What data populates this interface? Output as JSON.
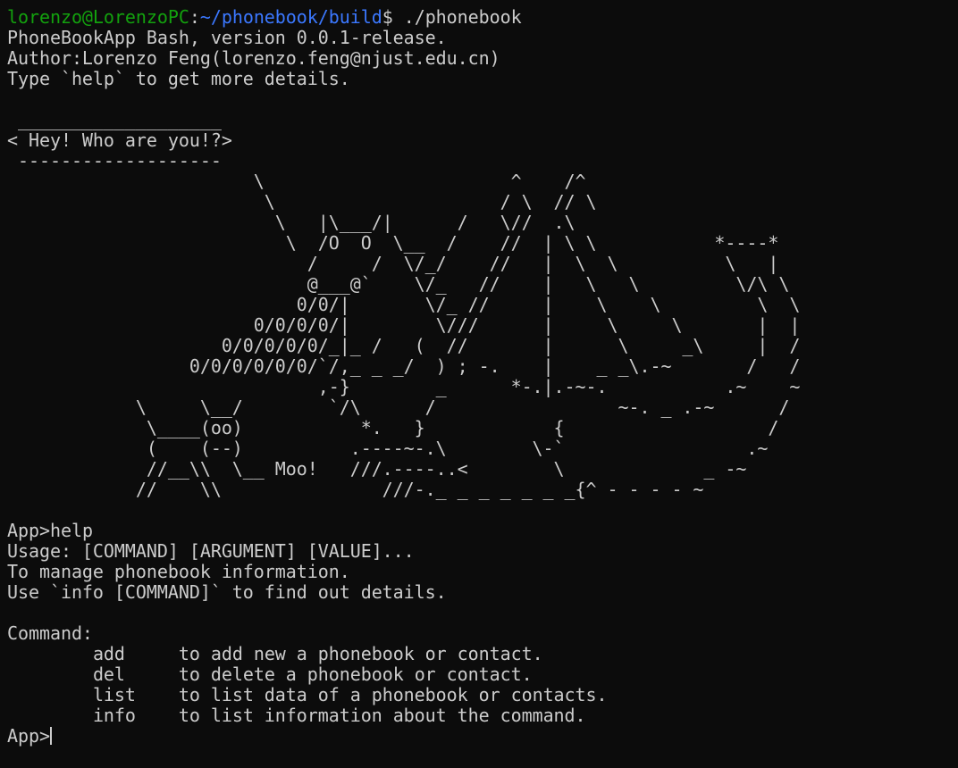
{
  "colors": {
    "background": "#0c0c0c",
    "foreground": "#cccccc",
    "prompt_user": "#13a10e",
    "prompt_path": "#3b78ff"
  },
  "shell_prompt": {
    "user_host": "lorenzo@LorenzoPC",
    "colon": ":",
    "path": "~/phonebook/build",
    "dollar": "$",
    "command": " ./phonebook"
  },
  "banner": {
    "version_line": "PhoneBookApp Bash, version 0.0.1-release.",
    "author_line": "Author:Lorenzo Feng(lorenzo.feng@njust.edu.cn)",
    "hint_line": "Type `help` to get more details."
  },
  "ascii_art": " ___________________\n< Hey! Who are you!?>\n -------------------\n                       \\                       ^    /^\n                        \\                     / \\  // \\\n                         \\   |\\___/|      /   \\//  .\\\n                          \\  /O  O  \\__  /    //  | \\ \\           *----*\n                            /     /  \\/_/    //   |  \\  \\          \\   |\n                            @___@`    \\/_   //    |   \\   \\         \\/\\ \\\n                           0/0/|       \\/_ //     |    \\    \\         \\  \\\n                       0/0/0/0/|        \\///      |     \\     \\       |  |\n                    0/0/0/0/0/_|_ /   (  //       |      \\     _\\     |  /\n                 0/0/0/0/0/0/`/,_ _ _/  ) ; -.    |    _ _\\.-~       /   /\n                             ,-}        _      *-.|.-~-.           .~    ~\n            \\     \\__/        `/\\      /                 ~-. _ .-~      /\n             \\____(oo)           *.   }            {                   /\n             (    (--)          .----~-.\\        \\-`                 .~\n             //__\\\\  \\__ Moo!   ///.----..<        \\             _ -~\n            //    \\\\               ///-._ _ _ _ _ _ _{^ - - - - ~",
  "app_session": {
    "prompt": "App>",
    "entered_command": "help",
    "usage_line": "Usage: [COMMAND] [ARGUMENT] [VALUE]...",
    "purpose_line": "To manage phonebook information.",
    "info_hint_line": "Use `info [COMMAND]` to find out details.",
    "commands_header": "Command:",
    "commands": [
      {
        "name": "add",
        "description": "to add new a phonebook or contact."
      },
      {
        "name": "del",
        "description": "to delete a phonebook or contact."
      },
      {
        "name": "list",
        "description": "to list data of a phonebook or contacts."
      },
      {
        "name": "info",
        "description": "to list information about the command."
      }
    ],
    "final_prompt": "App>"
  }
}
